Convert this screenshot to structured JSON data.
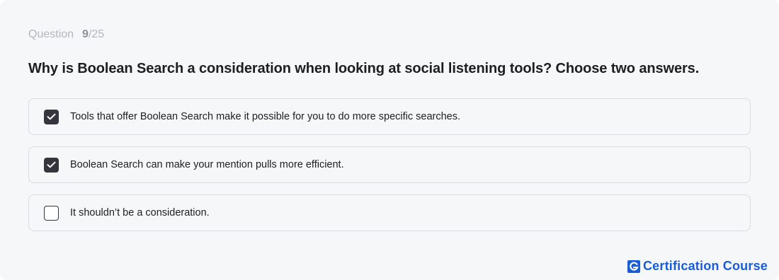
{
  "quiz": {
    "counter": {
      "label": "Question",
      "current": "9",
      "total_suffix": "/25"
    },
    "question": "Why is Boolean Search a consideration when looking at social listening tools? Choose two answers.",
    "options": [
      {
        "label": "Tools that offer Boolean Search make it possible for you to do more specific searches.",
        "checked": true
      },
      {
        "label": "Boolean Search can make your mention pulls more efficient.",
        "checked": true
      },
      {
        "label": "It shouldn’t be a consideration.",
        "checked": false
      }
    ]
  },
  "brand": {
    "logo_letter": "G",
    "text": "Certification Course",
    "color": "#1a5cd6"
  },
  "colors": {
    "background": "#f6f7f9",
    "checkbox_checked": "#36343d",
    "option_border": "#d9dbdf"
  }
}
